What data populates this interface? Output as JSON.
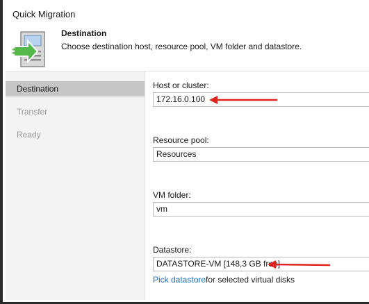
{
  "window": {
    "title": "Quick Migration"
  },
  "header": {
    "title": "Destination",
    "subtitle": "Choose destination host, resource pool, VM folder and datastore.",
    "logo_icon": "server-migration-icon",
    "accent": "#54b948"
  },
  "steps": [
    {
      "label": "Destination",
      "active": true
    },
    {
      "label": "Transfer",
      "active": false
    },
    {
      "label": "Ready",
      "active": false
    }
  ],
  "form": {
    "host_label": "Host or cluster:",
    "host_value": "172.16.0.100",
    "pool_label": "Resource pool:",
    "pool_value": "Resources",
    "folder_label": "VM folder:",
    "folder_value": "vm",
    "datastore_label": "Datastore:",
    "datastore_value": "DATASTORE-VM [148,3 GB free]",
    "pick_link": "Pick datastore",
    "pick_suffix": "for selected virtual disks"
  },
  "annotation": {
    "arrow_color": "#e0241b"
  }
}
